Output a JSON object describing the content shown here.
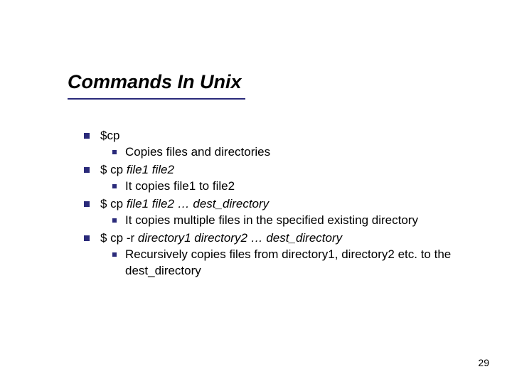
{
  "slide": {
    "title": "Commands In Unix",
    "page_number": "29",
    "items": [
      {
        "heading_parts": [
          {
            "text": "$cp",
            "italic": false
          }
        ],
        "sub": [
          "Copies files and directories"
        ]
      },
      {
        "heading_parts": [
          {
            "text": "$ cp ",
            "italic": false
          },
          {
            "text": "file1 file2",
            "italic": true
          }
        ],
        "sub": [
          "It copies file1 to file2"
        ]
      },
      {
        "heading_parts": [
          {
            "text": "$ cp ",
            "italic": false
          },
          {
            "text": "file1 file2 … dest_directory",
            "italic": true
          }
        ],
        "sub": [
          "It copies multiple files in the specified existing directory"
        ]
      },
      {
        "heading_parts": [
          {
            "text": "$ cp -r ",
            "italic": false
          },
          {
            "text": "directory1 directory2 … dest_directory",
            "italic": true
          }
        ],
        "sub": [
          "Recursively copies files from directory1, directory2 etc. to the dest_directory"
        ]
      }
    ]
  }
}
